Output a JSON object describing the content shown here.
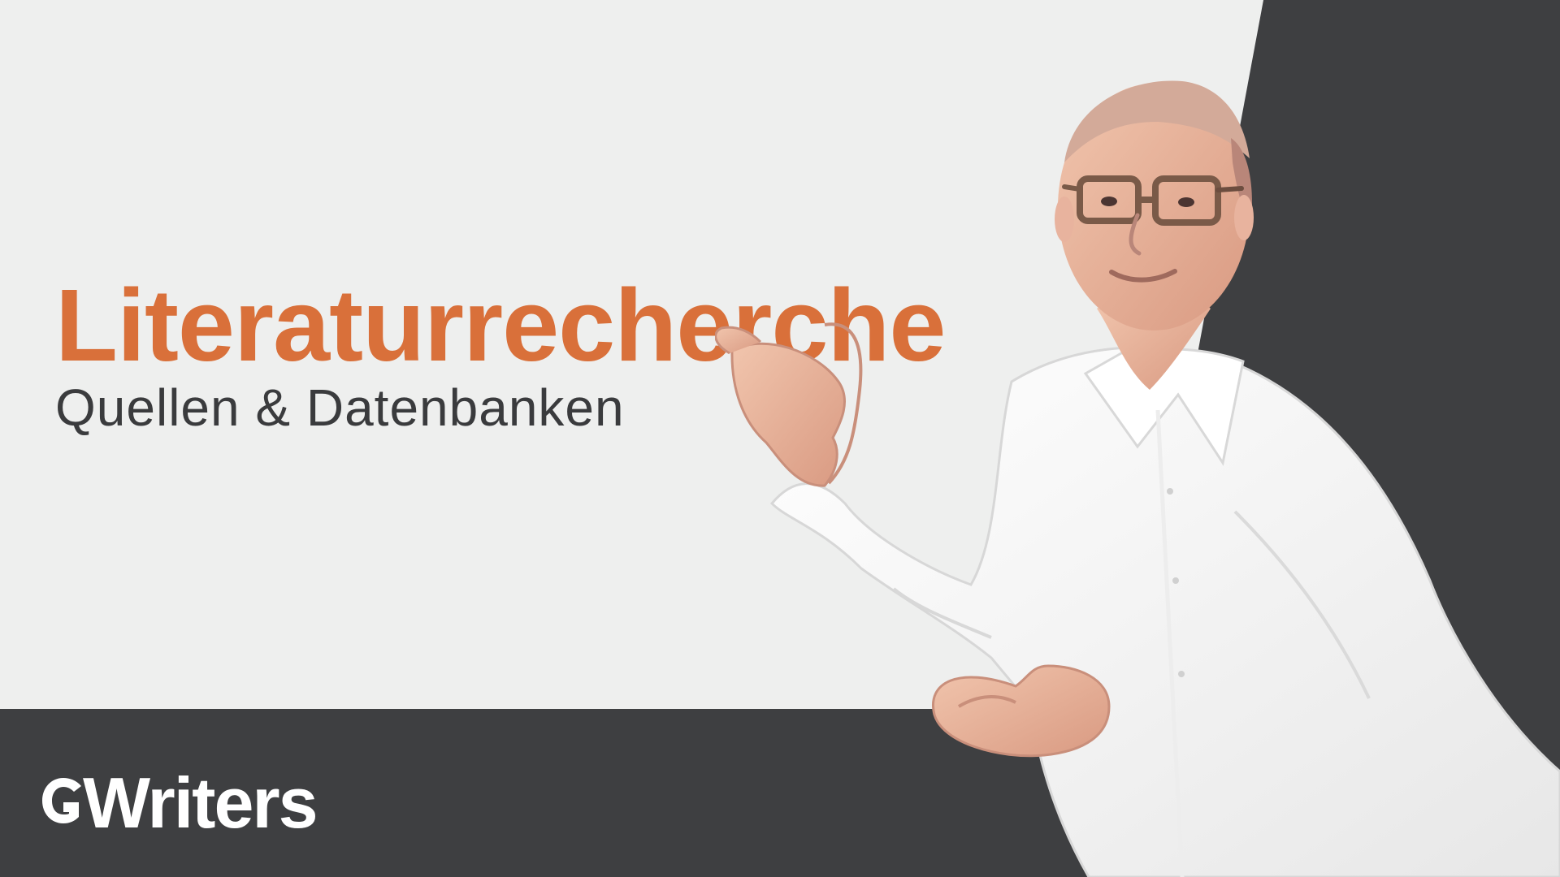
{
  "title": {
    "headline": "Literaturrecherche",
    "subheadline": "Quellen & Datenbanken"
  },
  "logo": {
    "text": "Writers",
    "icon": "gwriters-logo-mark"
  },
  "presenter": {
    "icon": "presenter-photo"
  },
  "colors": {
    "background": "#eeefee",
    "dark_panel": "#3e3f41",
    "accent": "#d9703a",
    "subheadline": "#3a3b3d",
    "logo": "#ffffff"
  }
}
